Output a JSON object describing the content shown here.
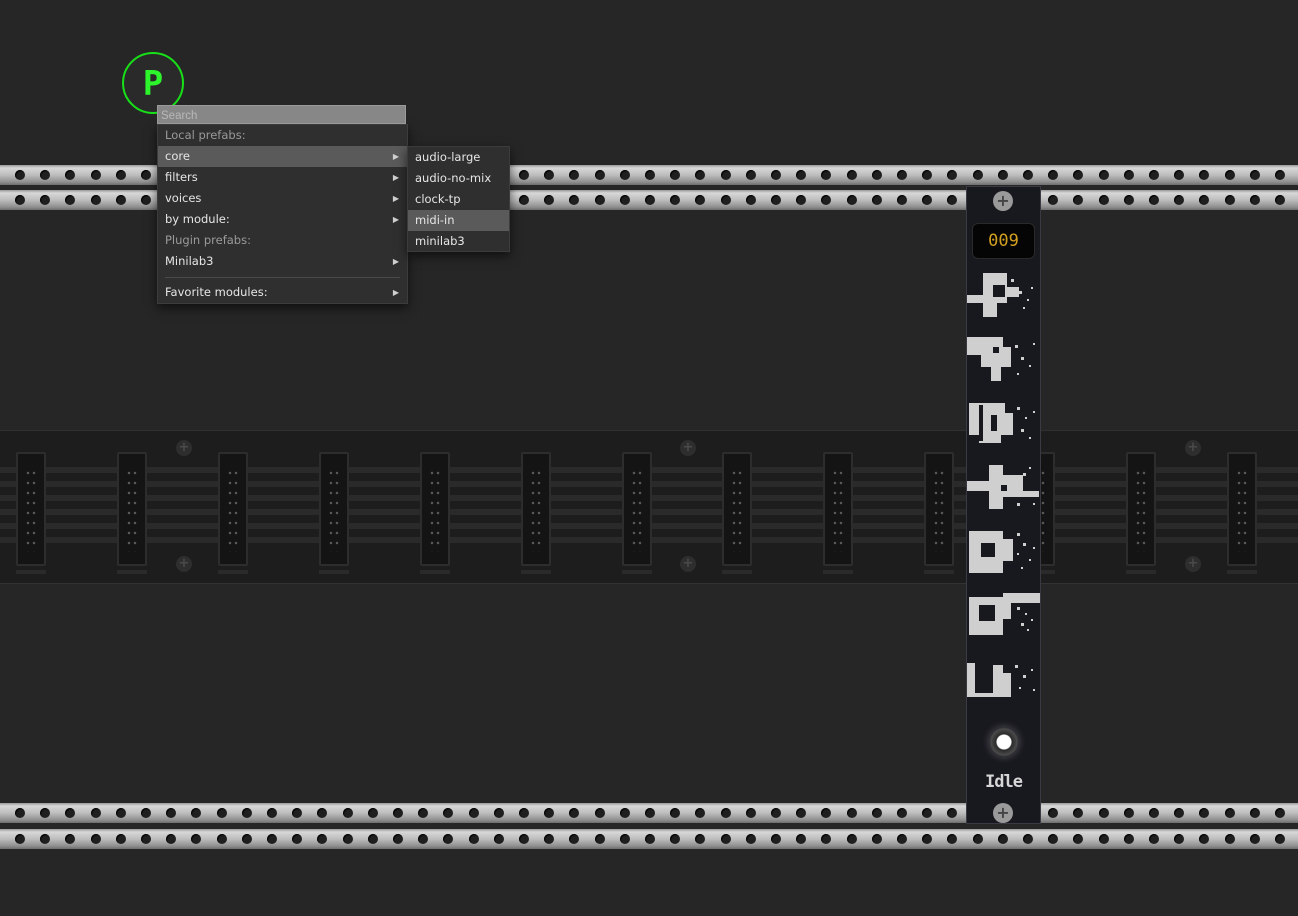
{
  "patch_badge": {
    "letter": "P",
    "color": "#18e018"
  },
  "search": {
    "placeholder": "Search",
    "value": ""
  },
  "main_menu": {
    "items": [
      {
        "label": "Local prefabs:",
        "kind": "header"
      },
      {
        "label": "core",
        "kind": "submenu",
        "selected": true
      },
      {
        "label": "filters",
        "kind": "submenu"
      },
      {
        "label": "voices",
        "kind": "submenu"
      },
      {
        "label": "by module:",
        "kind": "submenu"
      },
      {
        "label": "Plugin prefabs:",
        "kind": "header"
      },
      {
        "label": "Minilab3",
        "kind": "submenu"
      },
      {
        "label": "Favorite modules:",
        "kind": "submenu"
      }
    ]
  },
  "sub_menu": {
    "items": [
      {
        "label": "audio-large"
      },
      {
        "label": "audio-no-mix"
      },
      {
        "label": "clock-tp"
      },
      {
        "label": "midi-in",
        "selected": true
      },
      {
        "label": "minilab3"
      }
    ]
  },
  "module": {
    "display_value": "009",
    "display_color": "#d4a020",
    "label": "Idle"
  }
}
